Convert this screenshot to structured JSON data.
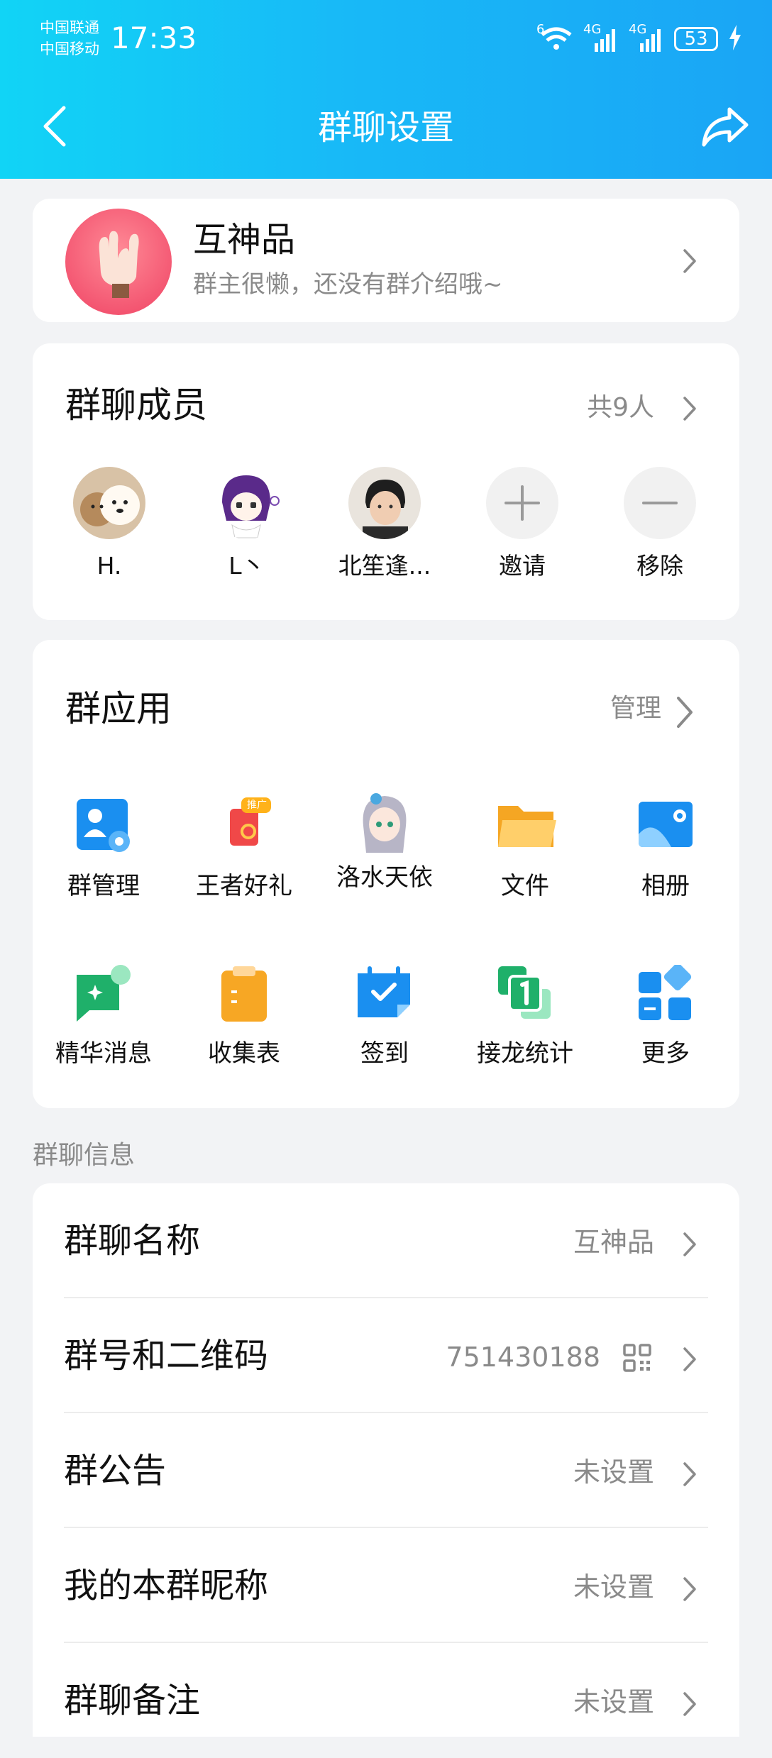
{
  "status_bar": {
    "carrier1": "中国联通",
    "carrier2": "中国移动",
    "time": "17:33",
    "wifi_badge": "6",
    "net1": "4G",
    "net2": "4G",
    "battery": "53",
    "icons": [
      "wifi-icon",
      "signal-icon",
      "signal-icon",
      "battery-icon",
      "charging-icon"
    ]
  },
  "header": {
    "title": "群聊设置",
    "back_icon": "chevron-left-icon",
    "share_icon": "share-arrow-icon"
  },
  "group": {
    "name": "互神品",
    "intro": "群主很懒，还没有群介绍哦~"
  },
  "members_section": {
    "title": "群聊成员",
    "count_label": "共9人",
    "members": [
      {
        "name": "H."
      },
      {
        "name": "L丶"
      },
      {
        "name": "北笙逢..."
      }
    ],
    "actions": [
      {
        "label": "邀请",
        "icon": "plus-icon"
      },
      {
        "label": "移除",
        "icon": "minus-icon"
      }
    ]
  },
  "apps_section": {
    "title": "群应用",
    "manage_label": "管理",
    "apps": [
      {
        "label": "群管理",
        "icon": "group-manage-icon"
      },
      {
        "label": "王者好礼",
        "icon": "gift-icon",
        "badge": "推广"
      },
      {
        "label": "洛水天依",
        "icon": "character-icon"
      },
      {
        "label": "文件",
        "icon": "folder-icon"
      },
      {
        "label": "相册",
        "icon": "album-icon"
      },
      {
        "label": "精华消息",
        "icon": "highlight-message-icon"
      },
      {
        "label": "收集表",
        "icon": "clipboard-icon"
      },
      {
        "label": "签到",
        "icon": "checkin-calendar-icon"
      },
      {
        "label": "接龙统计",
        "icon": "chain-count-icon"
      },
      {
        "label": "更多",
        "icon": "more-grid-icon"
      }
    ]
  },
  "info_section": {
    "label": "群聊信息",
    "rows": [
      {
        "label": "群聊名称",
        "value": "互神品"
      },
      {
        "label": "群号和二维码",
        "value": "751430188"
      },
      {
        "label": "群公告",
        "value": "未设置"
      },
      {
        "label": "我的本群昵称",
        "value": "未设置"
      },
      {
        "label": "群聊备注",
        "value": "未设置"
      }
    ]
  },
  "colors": {
    "header_start": "#11d4f6",
    "header_end": "#1aa5f5",
    "background": "#f2f3f5",
    "secondary_text": "#8a8a8a"
  }
}
